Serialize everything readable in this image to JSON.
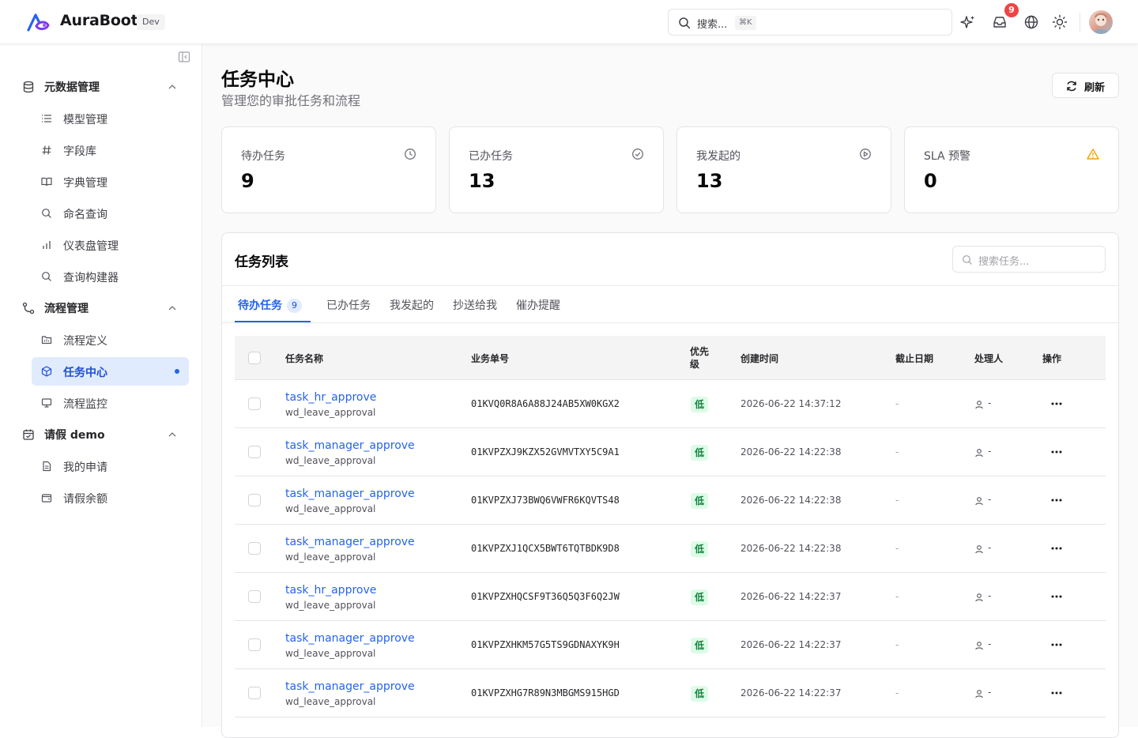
{
  "header": {
    "brand": "AuraBoot",
    "env_badge": "Dev",
    "search_placeholder": "搜索...",
    "search_shortcut": "⌘K",
    "notification_count": "9"
  },
  "sidebar": {
    "groups": [
      {
        "label": "元数据管理",
        "icon": "database-icon",
        "items": [
          {
            "label": "模型管理",
            "icon": "list-icon"
          },
          {
            "label": "字段库",
            "icon": "hash-icon"
          },
          {
            "label": "字典管理",
            "icon": "book-icon"
          },
          {
            "label": "命名查询",
            "icon": "search-icon"
          },
          {
            "label": "仪表盘管理",
            "icon": "bar-chart-icon"
          },
          {
            "label": "查询构建器",
            "icon": "search-icon"
          }
        ]
      },
      {
        "label": "流程管理",
        "icon": "workflow-icon",
        "items": [
          {
            "label": "流程定义",
            "icon": "folder-icon"
          },
          {
            "label": "任务中心",
            "icon": "cube-icon",
            "active": true
          },
          {
            "label": "流程监控",
            "icon": "monitor-icon"
          }
        ]
      },
      {
        "label": "请假 demo",
        "icon": "calendar-icon",
        "items": [
          {
            "label": "我的申请",
            "icon": "file-icon"
          },
          {
            "label": "请假余额",
            "icon": "wallet-icon"
          }
        ]
      }
    ]
  },
  "page": {
    "title": "任务中心",
    "subtitle": "管理您的审批任务和流程",
    "refresh_label": "刷新"
  },
  "stats": [
    {
      "label": "待办任务",
      "value": "9",
      "icon": "clock-icon"
    },
    {
      "label": "已办任务",
      "value": "13",
      "icon": "check-circle-icon"
    },
    {
      "label": "我发起的",
      "value": "13",
      "icon": "play-circle-icon"
    },
    {
      "label": "SLA 预警",
      "value": "0",
      "icon": "warning-icon",
      "icon_color": "#f59e0b"
    }
  ],
  "task_list": {
    "title": "任务列表",
    "search_placeholder": "搜索任务...",
    "tabs": [
      {
        "label": "待办任务",
        "count": "9",
        "active": true
      },
      {
        "label": "已办任务"
      },
      {
        "label": "我发起的"
      },
      {
        "label": "抄送给我"
      },
      {
        "label": "催办提醒"
      }
    ],
    "columns": {
      "name": "任务名称",
      "business_no": "业务单号",
      "priority": "优先级",
      "created": "创建时间",
      "deadline": "截止日期",
      "assignee": "处理人",
      "actions": "操作"
    },
    "rows": [
      {
        "name": "task_hr_approve",
        "key": "wd_leave_approval",
        "business_no": "01KVQ0R8A6A88J24AB5XW0KGX2",
        "priority": "低",
        "created": "2026-06-22 14:37:12",
        "deadline": "-",
        "assignee": "-"
      },
      {
        "name": "task_manager_approve",
        "key": "wd_leave_approval",
        "business_no": "01KVPZXJ9KZX52GVMVTXY5C9A1",
        "priority": "低",
        "created": "2026-06-22 14:22:38",
        "deadline": "-",
        "assignee": "-"
      },
      {
        "name": "task_manager_approve",
        "key": "wd_leave_approval",
        "business_no": "01KVPZXJ73BWQ6VWFR6KQVTS48",
        "priority": "低",
        "created": "2026-06-22 14:22:38",
        "deadline": "-",
        "assignee": "-"
      },
      {
        "name": "task_manager_approve",
        "key": "wd_leave_approval",
        "business_no": "01KVPZXJ1QCX5BWT6TQTBDK9D8",
        "priority": "低",
        "created": "2026-06-22 14:22:38",
        "deadline": "-",
        "assignee": "-"
      },
      {
        "name": "task_hr_approve",
        "key": "wd_leave_approval",
        "business_no": "01KVPZXHQCSF9T36Q5Q3F6Q2JW",
        "priority": "低",
        "created": "2026-06-22 14:22:37",
        "deadline": "-",
        "assignee": "-"
      },
      {
        "name": "task_manager_approve",
        "key": "wd_leave_approval",
        "business_no": "01KVPZXHKM57G5TS9GDNAXYK9H",
        "priority": "低",
        "created": "2026-06-22 14:22:37",
        "deadline": "-",
        "assignee": "-"
      },
      {
        "name": "task_manager_approve",
        "key": "wd_leave_approval",
        "business_no": "01KVPZXHG7R89N3MBGMS915HGD",
        "priority": "低",
        "created": "2026-06-22 14:22:37",
        "deadline": "-",
        "assignee": "-"
      }
    ]
  }
}
